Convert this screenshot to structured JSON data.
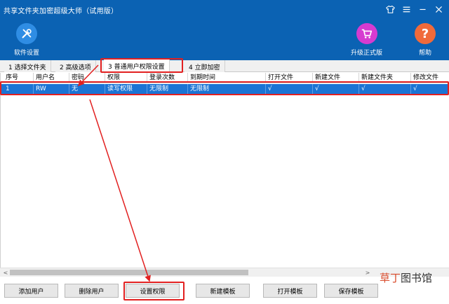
{
  "window": {
    "title": "共享文件夹加密超级大师（试用版）",
    "controls": [
      "shirt-icon",
      "menu-icon",
      "minimize-icon",
      "close-icon"
    ]
  },
  "toolbar": {
    "settings_label": "软件设置",
    "upgrade_label": "升级正式版",
    "help_label": "帮助",
    "help_glyph": "?"
  },
  "tabs": [
    {
      "label": "1 选择文件夹"
    },
    {
      "label": "2 高级选项"
    },
    {
      "label": "3 普通用户权限设置",
      "active": true
    },
    {
      "label": "4 立即加密"
    }
  ],
  "table": {
    "columns": [
      "序号",
      "用户名",
      "密码",
      "权限",
      "登录次数",
      "到期时间",
      "打开文件",
      "新建文件",
      "新建文件夹",
      "修改文件"
    ],
    "rows": [
      [
        "1",
        "RW",
        "无",
        "读写权限",
        "无限制",
        "无限制",
        "√",
        "√",
        "√",
        "√"
      ]
    ]
  },
  "scrollbar": {
    "left_arrow": "<",
    "right_arrow": ">"
  },
  "buttons": {
    "add_user": "添加用户",
    "delete_user": "删除用户",
    "set_permission": "设置权限",
    "new_template": "新建模板",
    "open_template": "打开模板",
    "save_template": "保存模板"
  },
  "watermark": {
    "part1": "草丁",
    "part2": "图书馆"
  },
  "colors": {
    "header_bg": "#0b62b3",
    "selected_row": "#1b74d4",
    "annotation": "#e22020",
    "settings_icon_bg": "#2f8de4",
    "upgrade_icon_bg": "#d63bd0",
    "help_icon_bg": "#f06a3a"
  }
}
